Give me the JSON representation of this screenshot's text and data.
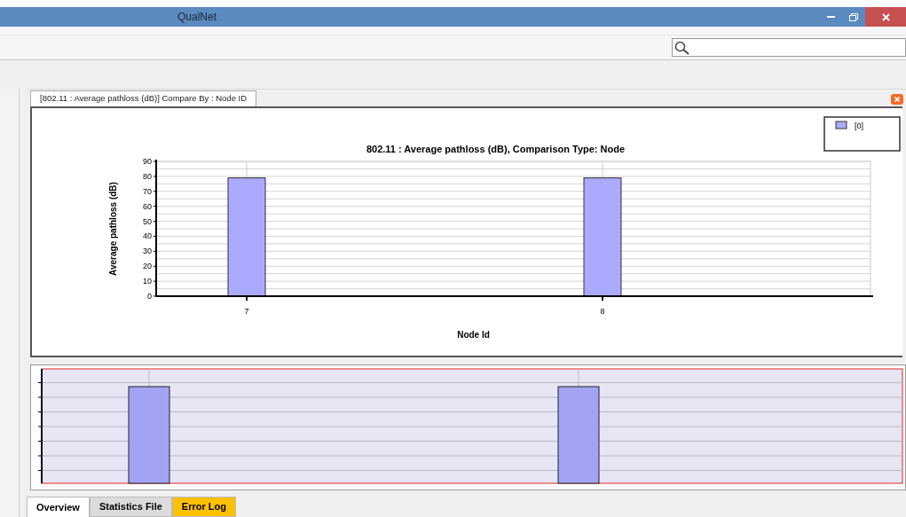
{
  "window": {
    "title": "QualNet"
  },
  "chart_tab": {
    "label": "[802.11 :  Average pathloss (dB)] Compare By : Node ID",
    "selected": true
  },
  "chart": {
    "chart_data": {
      "type": "bar",
      "title": "802.11 :  Average pathloss (dB), Comparison Type: Node",
      "xlabel": "Node Id",
      "ylabel": "Average pathloss (dB)",
      "categories": [
        "7",
        "8"
      ],
      "series": [
        {
          "name": "[0]",
          "color": "#aaaaff",
          "values": [
            79,
            79
          ]
        }
      ],
      "ylim": [
        0,
        90
      ],
      "yticks": [
        0,
        10,
        20,
        30,
        40,
        50,
        60,
        70,
        80,
        90
      ],
      "grid": true
    }
  },
  "bottom_tabs": [
    {
      "label": "Overview",
      "selected": true,
      "color": "#ffffff"
    },
    {
      "label": "Statistics File",
      "selected": false,
      "color": "#dcdcdc"
    },
    {
      "label": "Error Log",
      "selected": false,
      "color": "#ffc000"
    }
  ]
}
